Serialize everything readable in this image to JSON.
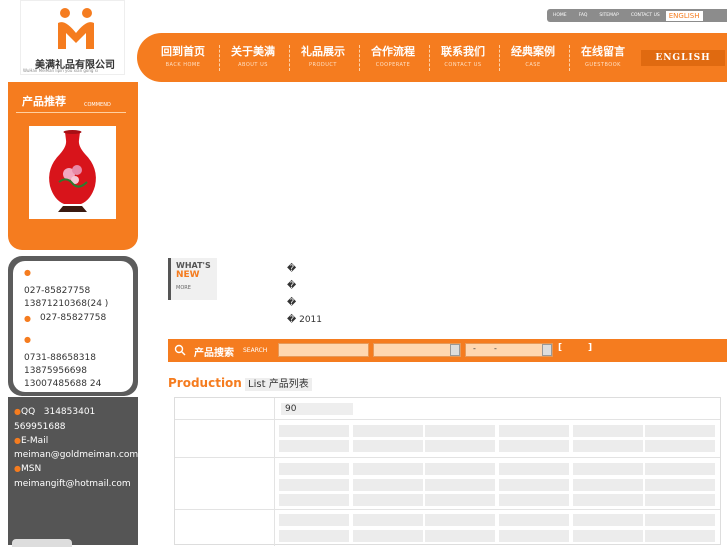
{
  "logo": {
    "cn_name": "美满礼品有限公司",
    "en_name": "WuHan MeiMan lipin you xian gong si"
  },
  "toplinks": [
    "HOME",
    "FAQ",
    "SITEMAP",
    "CONTACT US"
  ],
  "toplink_english": "ENGLISH",
  "nav": [
    {
      "cn": "回到首页",
      "en": "BACK HOME"
    },
    {
      "cn": "关于美满",
      "en": "ABOUT US"
    },
    {
      "cn": "礼品展示",
      "en": "PRODUCT"
    },
    {
      "cn": "合作流程",
      "en": "COOPERATE"
    },
    {
      "cn": "联系我们",
      "en": "CONTACT US"
    },
    {
      "cn": "经典案例",
      "en": "CASE"
    },
    {
      "cn": "在线留言",
      "en": "GUESTBOOK"
    }
  ],
  "nav_english": "ENGLISH",
  "recommend": {
    "title": "产品推荐",
    "subtitle": "COMMEND"
  },
  "contact": {
    "line1": "027-85827758",
    "line2": "13871210368(24  )",
    "line3": "027-85827758",
    "line4": "0731-88658318",
    "line5": "13875956698",
    "line6": "13007485688 24"
  },
  "im": {
    "qq_label": "QQ",
    "qq1": "314853401",
    "qq2": "569951688",
    "email_label": "E-Mail",
    "email": "meiman@goldmeiman.com",
    "msn_label": "MSN",
    "msn": "meimangift@hotmail.com"
  },
  "whatsnew": {
    "line1": "WHAT'S",
    "line2": "NEW",
    "more": "MORE"
  },
  "news": [
    "�",
    "�",
    "�",
    "� 2011"
  ],
  "search": {
    "label": "产品搜索",
    "label_en": "SEARCH",
    "dash": "-",
    "dash2": "-",
    "bracket_open": "[",
    "bracket_close": "]"
  },
  "production": {
    "title_en": "Production",
    "title_rest": "List 产品列表"
  },
  "table": {
    "first_value": "90"
  },
  "colors": {
    "accent": "#f57c1f",
    "dark_panel": "#5c5c5c"
  }
}
